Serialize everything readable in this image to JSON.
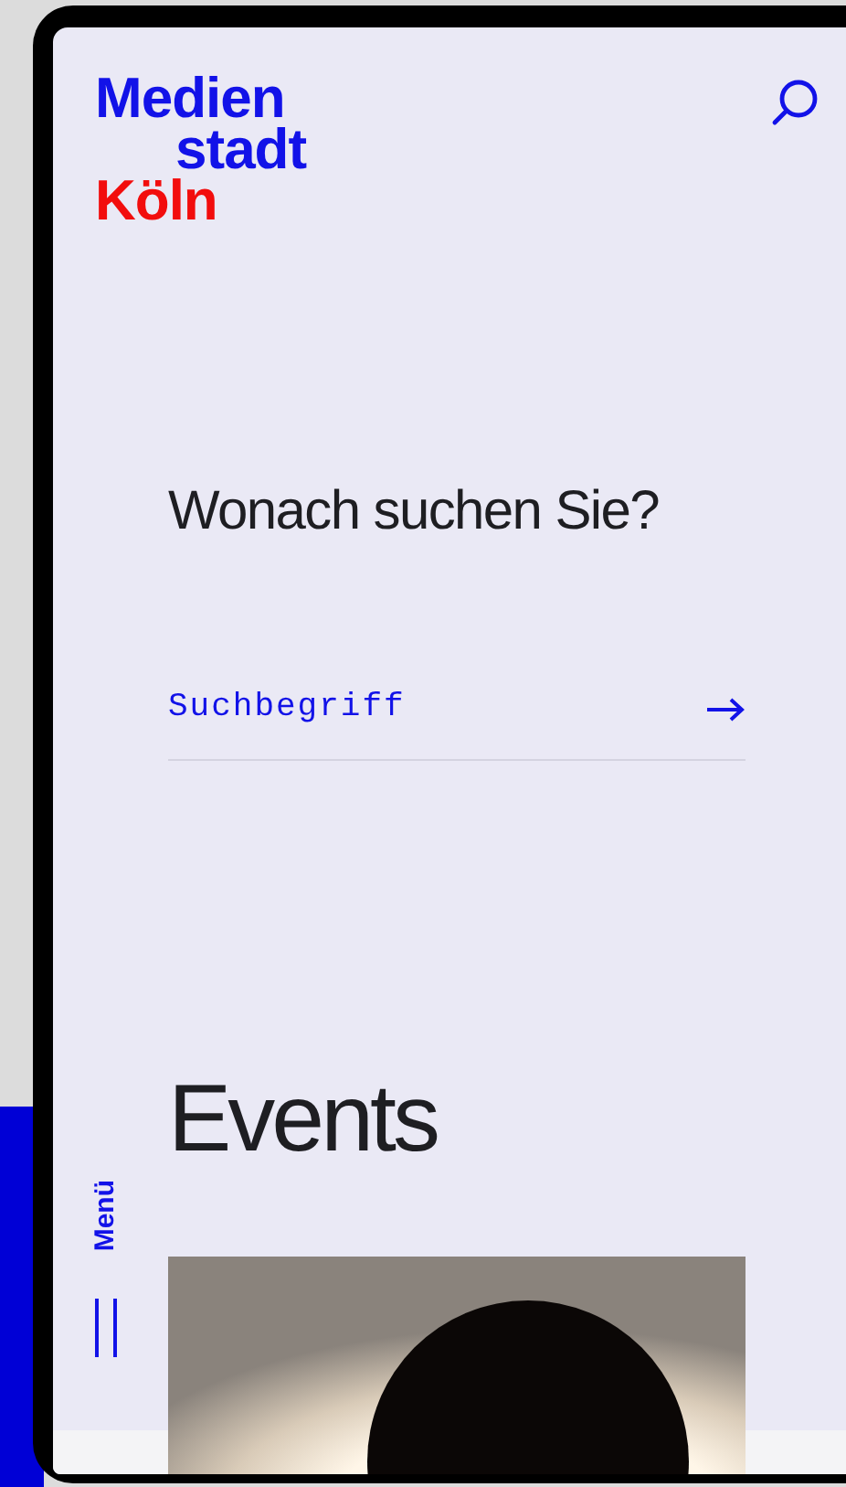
{
  "logo": {
    "lines": [
      {
        "text": "Medien",
        "color": "#1212e8",
        "indented": false
      },
      {
        "text": "stadt",
        "color": "#1212e8",
        "indented": true
      },
      {
        "text": "Köln",
        "color": "#f20d0d",
        "indented": false
      }
    ]
  },
  "search_prompt": {
    "heading": "Wonach suchen Sie?",
    "placeholder": "Suchbegriff"
  },
  "section_title": "Events",
  "menu": {
    "label": "Menü"
  }
}
